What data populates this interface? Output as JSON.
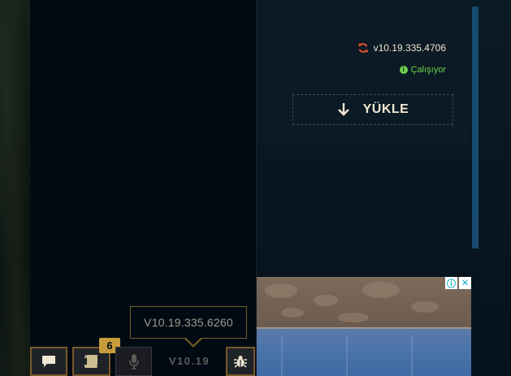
{
  "patch": {
    "version": "v10.19.335.4706",
    "status": "Çalışıyor",
    "install_label": "YÜKLE"
  },
  "footer": {
    "tooltip": "V10.19.335.6260",
    "version_short": "V10.19",
    "missions_badge": "6"
  },
  "ad": {
    "info_glyph": "ⓘ",
    "close_glyph": "✕"
  },
  "colors": {
    "gold": "#c89b3c",
    "gold_border": "#785a28",
    "status_green": "#6fd34a",
    "refresh_orange": "#e8552a",
    "scrollbar_blue": "#164b6d"
  }
}
